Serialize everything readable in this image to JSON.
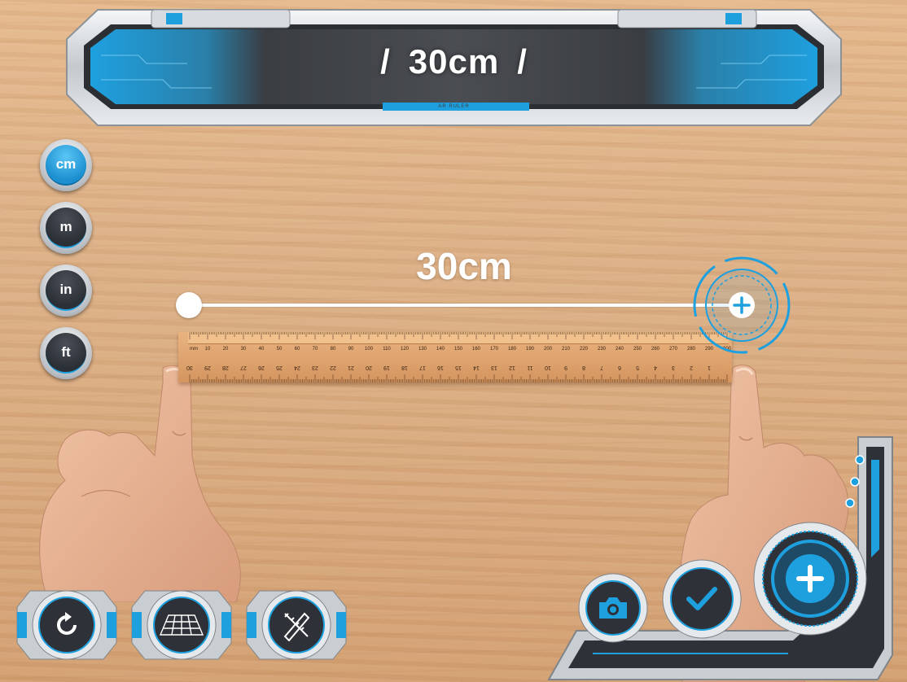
{
  "app": {
    "title": "AR Ruler"
  },
  "header": {
    "slash_left": "/",
    "measurement": "30cm",
    "slash_right": "/",
    "caption": "AR RULER"
  },
  "units": [
    {
      "label": "cm",
      "active": true
    },
    {
      "label": "m",
      "active": false
    },
    {
      "label": "in",
      "active": false
    },
    {
      "label": "ft",
      "active": false
    }
  ],
  "overlay": {
    "measurement_label": "30cm"
  },
  "ruler": {
    "mm_label": "mm",
    "top_scale": [
      "10",
      "20",
      "30",
      "40",
      "50",
      "60",
      "70",
      "80",
      "90",
      "100",
      "110",
      "120",
      "130",
      "140",
      "150",
      "160",
      "170",
      "180",
      "190",
      "200",
      "210",
      "220",
      "230",
      "240",
      "250",
      "260",
      "270",
      "280",
      "290",
      "300"
    ],
    "bottom_scale": [
      "1",
      "2",
      "3",
      "4",
      "5",
      "6",
      "7",
      "8",
      "9",
      "10",
      "11",
      "12",
      "13",
      "14",
      "15",
      "16",
      "17",
      "18",
      "19",
      "20",
      "21",
      "22",
      "23",
      "24",
      "25",
      "26",
      "27",
      "28",
      "29",
      "30"
    ]
  },
  "tools": [
    {
      "name": "reset",
      "icon": "refresh-icon"
    },
    {
      "name": "plane",
      "icon": "grid-plane-icon"
    },
    {
      "name": "edit",
      "icon": "pencil-ruler-icon"
    }
  ],
  "actions": [
    {
      "name": "camera",
      "icon": "camera-icon"
    },
    {
      "name": "confirm",
      "icon": "check-icon"
    },
    {
      "name": "add",
      "icon": "plus-icon"
    }
  ],
  "colors": {
    "accent": "#1ea0df",
    "panel_dark": "#2e3238",
    "panel_metal": "#c9ced3",
    "wood": "#ddb085"
  }
}
